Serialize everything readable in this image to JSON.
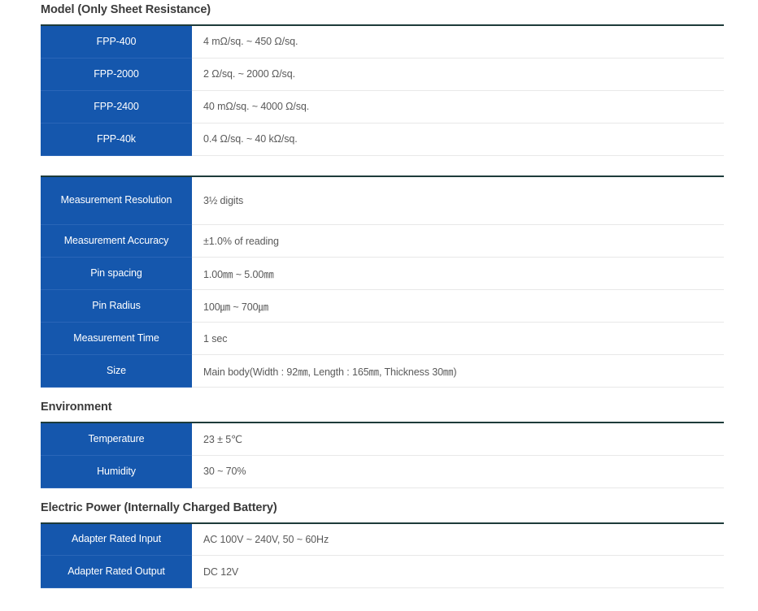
{
  "sections": [
    {
      "heading": "Model (Only Sheet Resistance)",
      "rows": [
        {
          "label": "FPP-400",
          "value": "4 mΩ/sq. ~ 450 Ω/sq."
        },
        {
          "label": "FPP-2000",
          "value": "2 Ω/sq. ~ 2000 Ω/sq."
        },
        {
          "label": "FPP-2400",
          "value": "40 mΩ/sq. ~ 4000 Ω/sq."
        },
        {
          "label": "FPP-40k",
          "value": "0.4 Ω/sq. ~ 40 kΩ/sq."
        }
      ]
    },
    {
      "heading": "",
      "rows": [
        {
          "label": "Measurement Resolution",
          "value": "3½ digits"
        },
        {
          "label": "Measurement Accuracy",
          "value": "±1.0% of reading"
        },
        {
          "label": "Pin spacing",
          "value": "1.00㎜ ~ 5.00㎜"
        },
        {
          "label": "Pin Radius",
          "value": "100㎛ ~ 700㎛"
        },
        {
          "label": "Measurement Time",
          "value": "1 sec"
        },
        {
          "label": "Size",
          "value": "Main body(Width : 92㎜, Length : 165㎜, Thickness 30㎜)"
        }
      ]
    },
    {
      "heading": "Environment",
      "rows": [
        {
          "label": "Temperature",
          "value": "23 ± 5℃"
        },
        {
          "label": "Humidity",
          "value": "30 ~ 70%"
        }
      ]
    },
    {
      "heading": "Electric Power (Internally Charged Battery)",
      "rows": [
        {
          "label": "Adapter Rated Input",
          "value": "AC 100V ~ 240V, 50 ~ 60Hz"
        },
        {
          "label": "Adapter Rated Output",
          "value": "DC 12V"
        }
      ]
    }
  ],
  "colors": {
    "label_blue": "#1557ad",
    "table_top_border": "#1d3b3a",
    "heading_text": "#3b3b3b",
    "value_text": "#595959",
    "row_divider": "#e8e8e8"
  }
}
